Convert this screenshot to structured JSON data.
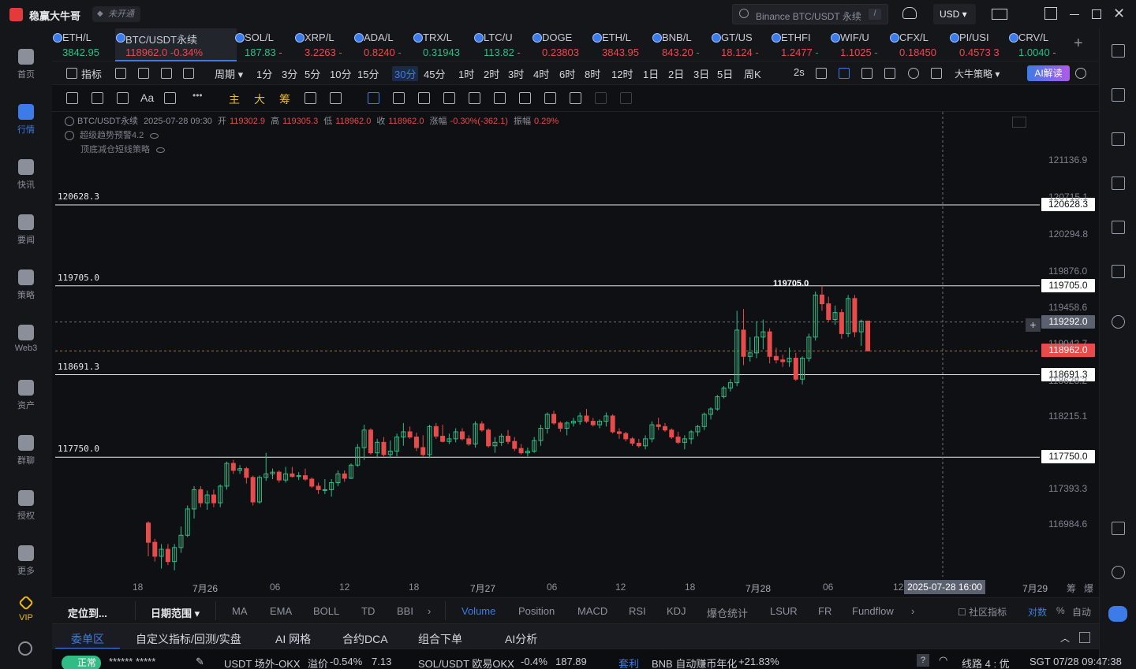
{
  "app": {
    "title": "稳赢大牛哥",
    "unlock_label": "未开通",
    "search_placeholder": "Binance BTC/USDT 永续",
    "search_key": "/",
    "currency": "USD ▾"
  },
  "left_nav": [
    {
      "label": "首页"
    },
    {
      "label": "行情"
    },
    {
      "label": "快讯"
    },
    {
      "label": "要闻"
    },
    {
      "label": "策略"
    },
    {
      "label": "Web3"
    },
    {
      "label": "资产"
    },
    {
      "label": "群聊"
    },
    {
      "label": "授权"
    },
    {
      "label": "更多"
    },
    {
      "label": "VIP"
    }
  ],
  "tickers": [
    {
      "name": "ETH/L",
      "price": "3842.95",
      "change": "",
      "dir": "up"
    },
    {
      "name": "BTC/USDT永续",
      "price": "118962.0",
      "change": "-0.34%",
      "dir": "down"
    },
    {
      "name": "SOL/L",
      "price": "187.83",
      "change": "-",
      "dir": "up"
    },
    {
      "name": "XRP/L",
      "price": "3.2263",
      "change": "-",
      "dir": "down"
    },
    {
      "name": "ADA/L",
      "price": "0.8240",
      "change": "-",
      "dir": "down"
    },
    {
      "name": "TRX/L",
      "price": "0.31943",
      "change": "",
      "dir": "up"
    },
    {
      "name": "LTC/U",
      "price": "113.82",
      "change": "-",
      "dir": "up"
    },
    {
      "name": "DOGE",
      "price": "0.23803",
      "change": "",
      "dir": "down"
    },
    {
      "name": "ETH/L",
      "price": "3843.95",
      "change": "",
      "dir": "down"
    },
    {
      "name": "BNB/L",
      "price": "843.20",
      "change": "-",
      "dir": "down"
    },
    {
      "name": "GT/US",
      "price": "18.124",
      "change": "-",
      "dir": "down"
    },
    {
      "name": "ETHFI",
      "price": "1.2477",
      "change": "-",
      "dir": "down"
    },
    {
      "name": "WIF/U",
      "price": "1.1025",
      "change": "-",
      "dir": "down"
    },
    {
      "name": "CFX/L",
      "price": "0.18450",
      "change": "",
      "dir": "down"
    },
    {
      "name": "PI/USI",
      "price": "0.4573",
      "change": "3",
      "dir": "down"
    },
    {
      "name": "CRV/L",
      "price": "1.0040",
      "change": "-",
      "dir": "up"
    }
  ],
  "periodbar": {
    "indicator": "指标",
    "period": "周期 ▾",
    "periods": [
      "1分",
      "3分",
      "5分",
      "10分",
      "15分",
      "30分",
      "45分",
      "1时",
      "2时",
      "3时",
      "4时",
      "6时",
      "8时",
      "12时",
      "1日",
      "2日",
      "3日",
      "5日",
      "周K"
    ],
    "selected_period": "30分",
    "refresh": "2s",
    "strategy": "大牛策略 ▾",
    "ai_button": "AI解读"
  },
  "drawbar": {
    "font_tool": "Aa",
    "chips": [
      "主",
      "大",
      "筹"
    ]
  },
  "chart_info": {
    "symbol": "BTC/USDT永续",
    "datetime": "2025-07-28 09:30",
    "open_label": "开",
    "open": "119302.9",
    "high_label": "高",
    "high": "119305.3",
    "low_label": "低",
    "low": "118962.0",
    "close_label": "收",
    "close": "118962.0",
    "change_label": "涨幅",
    "change": "-0.30%(-362.1)",
    "amp_label": "振幅",
    "amp": "0.29%",
    "indicator1": "超级趋势预警4.2",
    "indicator2": "顶底减仓短线策略"
  },
  "chart_data": {
    "type": "candlestick",
    "y_ticks": [
      "121136.9",
      "120715.1",
      "120294.8",
      "119876.0",
      "119458.6",
      "119042.7",
      "118628.2",
      "118215.1",
      "117393.3",
      "116984.6"
    ],
    "x_ticks": [
      "18",
      "7月26",
      "06",
      "12",
      "18",
      "7月27",
      "06",
      "12",
      "18",
      "7月28",
      "06",
      "12",
      "7月29"
    ],
    "h_lines": [
      "120628.3",
      "119705.0",
      "118691.3",
      "117750.0"
    ],
    "last_price": "118962.0",
    "crosshair_price": "119292.0",
    "crosshair_time": "2025-07-28 16:00",
    "high_marker": "119705.0",
    "scale_pct": "筹",
    "scale_log": "爆",
    "ylim": [
      116800,
      121300
    ],
    "candles": [
      [
        117000,
        116620,
        117020,
        116780
      ],
      [
        116780,
        116560,
        116820,
        116620
      ],
      [
        116620,
        116480,
        116760,
        116700
      ],
      [
        116700,
        116520,
        116760,
        116560
      ],
      [
        116560,
        116460,
        116760,
        116720
      ],
      [
        116720,
        116660,
        116960,
        116860
      ],
      [
        116860,
        116840,
        117200,
        117160
      ],
      [
        117160,
        117050,
        117420,
        117380
      ],
      [
        117380,
        117180,
        117420,
        117230
      ],
      [
        117230,
        117150,
        117370,
        117320
      ],
      [
        117320,
        117180,
        117380,
        117230
      ],
      [
        117230,
        117180,
        117440,
        117420
      ],
      [
        117420,
        117380,
        117700,
        117680
      ],
      [
        117680,
        117560,
        117720,
        117600
      ],
      [
        117600,
        117560,
        117660,
        117620
      ],
      [
        117620,
        117450,
        117640,
        117520
      ],
      [
        117520,
        117200,
        117540,
        117240
      ],
      [
        117240,
        117220,
        117540,
        117520
      ],
      [
        117520,
        117480,
        117800,
        117560
      ],
      [
        117560,
        117500,
        117620,
        117580
      ],
      [
        117580,
        117460,
        117600,
        117490
      ],
      [
        117490,
        117460,
        117640,
        117560
      ],
      [
        117560,
        117520,
        117640,
        117530
      ],
      [
        117530,
        117490,
        117580,
        117540
      ],
      [
        117540,
        117480,
        117620,
        117500
      ],
      [
        117500,
        117400,
        117520,
        117420
      ],
      [
        117420,
        117330,
        117460,
        117380
      ],
      [
        117380,
        117330,
        117500,
        117380
      ],
      [
        117380,
        117300,
        117500,
        117460
      ],
      [
        117460,
        117420,
        117600,
        117560
      ],
      [
        117560,
        117470,
        117600,
        117510
      ],
      [
        117510,
        117500,
        117680,
        117660
      ],
      [
        117660,
        117640,
        117900,
        117860
      ],
      [
        117860,
        117720,
        118120,
        118060
      ],
      [
        118060,
        117780,
        118080,
        117800
      ],
      [
        117800,
        117740,
        117960,
        117920
      ],
      [
        117920,
        117760,
        117980,
        117780
      ],
      [
        117780,
        117740,
        117940,
        117820
      ],
      [
        117820,
        117760,
        118020,
        117980
      ],
      [
        117980,
        117880,
        118140,
        118040
      ],
      [
        118040,
        117960,
        118100,
        117980
      ],
      [
        117980,
        117820,
        118030,
        117860
      ],
      [
        117860,
        117760,
        118000,
        117780
      ],
      [
        117780,
        117740,
        118120,
        118100
      ],
      [
        118100,
        117960,
        118140,
        117990
      ],
      [
        117990,
        117920,
        118120,
        117930
      ],
      [
        117930,
        117900,
        118020,
        117960
      ],
      [
        117960,
        117920,
        118080,
        118040
      ],
      [
        118040,
        117940,
        118080,
        117960
      ],
      [
        117960,
        117880,
        118000,
        117900
      ],
      [
        117900,
        117860,
        118160,
        118130
      ],
      [
        118130,
        118040,
        118160,
        118060
      ],
      [
        118060,
        117860,
        118080,
        117880
      ],
      [
        117880,
        117800,
        117980,
        117920
      ],
      [
        117920,
        117880,
        118020,
        117990
      ],
      [
        117990,
        117900,
        118060,
        117930
      ],
      [
        117930,
        117820,
        117980,
        117850
      ],
      [
        117850,
        117780,
        117900,
        117800
      ],
      [
        117800,
        117760,
        117860,
        117820
      ],
      [
        117820,
        117800,
        117980,
        117940
      ],
      [
        117940,
        117880,
        118120,
        118080
      ],
      [
        118080,
        118020,
        118260,
        118240
      ],
      [
        118240,
        118120,
        118280,
        118140
      ],
      [
        118140,
        118040,
        118160,
        118080
      ],
      [
        118080,
        118000,
        118160,
        118140
      ],
      [
        118140,
        118100,
        118200,
        118160
      ],
      [
        118160,
        118120,
        118260,
        118220
      ],
      [
        118220,
        118140,
        118300,
        118160
      ],
      [
        118160,
        118100,
        118200,
        118120
      ],
      [
        118120,
        118080,
        118180,
        118160
      ],
      [
        118160,
        118100,
        118260,
        118220
      ],
      [
        118220,
        118020,
        118240,
        118040
      ],
      [
        118040,
        117960,
        118080,
        118020
      ],
      [
        118020,
        117930,
        118040,
        117960
      ],
      [
        117960,
        117880,
        117980,
        117910
      ],
      [
        117910,
        117860,
        117960,
        117880
      ],
      [
        117880,
        117840,
        118000,
        117960
      ],
      [
        117960,
        117920,
        118160,
        118120
      ],
      [
        118120,
        118060,
        118200,
        118100
      ],
      [
        118100,
        118040,
        118140,
        118060
      ],
      [
        118060,
        117960,
        118080,
        117980
      ],
      [
        117980,
        117900,
        118040,
        117920
      ],
      [
        117920,
        117840,
        118000,
        117960
      ],
      [
        117960,
        117900,
        118060,
        118040
      ],
      [
        118040,
        117990,
        118120,
        118100
      ],
      [
        118100,
        118060,
        118260,
        118240
      ],
      [
        118240,
        118180,
        118320,
        118300
      ],
      [
        118300,
        118280,
        118460,
        118440
      ],
      [
        118440,
        118420,
        118560,
        118540
      ],
      [
        118540,
        118500,
        118640,
        118600
      ],
      [
        118600,
        118560,
        119420,
        119200
      ],
      [
        119200,
        118800,
        119440,
        118900
      ],
      [
        118900,
        118840,
        119120,
        118940
      ],
      [
        118940,
        118880,
        119300,
        119120
      ],
      [
        119120,
        118980,
        119320,
        119180
      ],
      [
        119180,
        118820,
        119220,
        118900
      ],
      [
        118900,
        118820,
        119000,
        118860
      ],
      [
        118860,
        118780,
        118920,
        118840
      ],
      [
        118840,
        118780,
        119000,
        118880
      ],
      [
        118880,
        118620,
        118940,
        118640
      ],
      [
        118640,
        118580,
        118900,
        118880
      ],
      [
        118880,
        118840,
        119160,
        119120
      ],
      [
        119120,
        119080,
        119640,
        119600
      ],
      [
        119600,
        119420,
        119705,
        119500
      ],
      [
        119500,
        119300,
        119580,
        119320
      ],
      [
        119320,
        119260,
        119480,
        119400
      ],
      [
        119400,
        119100,
        119440,
        119160
      ],
      [
        119160,
        119120,
        119600,
        119560
      ],
      [
        119560,
        119120,
        119600,
        119180
      ],
      [
        119180,
        119020,
        119320,
        119302
      ],
      [
        119302.9,
        118962,
        119305.3,
        118962
      ]
    ]
  },
  "indbar": {
    "locate": "定位到...",
    "date_range": "日期范围 ▾",
    "items": [
      "MA",
      "EMA",
      "BOLL",
      "TD",
      "BBI"
    ],
    "sub_items": [
      "Volume",
      "Position",
      "MACD",
      "RSI",
      "KDJ",
      "爆仓统计",
      "LSUR",
      "FR",
      "Fundflow"
    ],
    "selected": "Volume",
    "community": "社区指标",
    "log_scale": "对数",
    "pct": "%",
    "auto": "自动"
  },
  "tabs": [
    "委单区",
    "自定义指标/回测/实盘",
    "AI 网格",
    "合约DCA",
    "组合下单",
    "AI分析"
  ],
  "statusbar": {
    "status": "正常",
    "account": "******  *****",
    "premium_market": "USDT 场外-OKX",
    "premium_label": "溢价",
    "premium_pct": "-0.54%",
    "premium_value": "7.13",
    "pair": "SOL/USDT 欧易OKX",
    "pair_change": "-0.4%",
    "pair_price": "187.89",
    "arb": "套利",
    "earn": "BNB 自动赚币年化",
    "earn_pct": "+21.83%",
    "route": "线路 4 : 优",
    "clock": "SGT 07/28 09:47:38"
  }
}
